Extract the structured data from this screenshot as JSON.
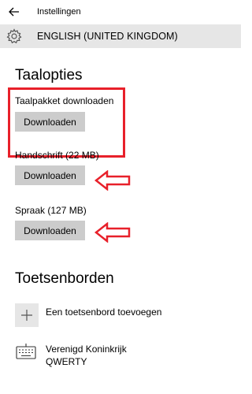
{
  "window": {
    "app_title": "Instellingen"
  },
  "header": {
    "title": "ENGLISH (UNITED KINGDOM)"
  },
  "language_options": {
    "heading": "Taalopties",
    "language_pack": {
      "label": "Taalpakket downloaden",
      "button": "Downloaden"
    },
    "handwriting": {
      "label": "Handschrift (22 MB)",
      "button": "Downloaden"
    },
    "speech": {
      "label": "Spraak (127 MB)",
      "button": "Downloaden"
    }
  },
  "keyboards": {
    "heading": "Toetsenborden",
    "add_label": "Een toetsenbord toevoegen",
    "items": [
      {
        "name": "Verenigd Koninkrijk",
        "layout": "QWERTY"
      }
    ]
  },
  "annotation_color": "#e8202a",
  "icons": [
    "back-arrow-icon",
    "gear-icon",
    "plus-icon",
    "keyboard-icon"
  ]
}
